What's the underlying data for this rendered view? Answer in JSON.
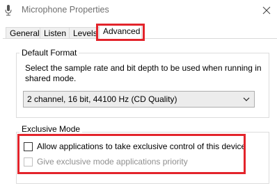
{
  "window": {
    "title": "Microphone Properties",
    "icon": "microphone-icon",
    "close_icon": "close-icon"
  },
  "tabs": [
    {
      "label": "General",
      "active": false
    },
    {
      "label": "Listen",
      "active": false
    },
    {
      "label": "Levels",
      "active": false
    },
    {
      "label": "Advanced",
      "active": true
    }
  ],
  "default_format": {
    "title": "Default Format",
    "description": "Select the sample rate and bit depth to be used when running in shared mode.",
    "selected": "2 channel, 16 bit, 44100 Hz (CD Quality)",
    "arrow_icon": "chevron-down-icon"
  },
  "exclusive_mode": {
    "title": "Exclusive Mode",
    "options": [
      {
        "label": "Allow applications to take exclusive control of this device",
        "checked": false,
        "enabled": true
      },
      {
        "label": "Give exclusive mode applications priority",
        "checked": false,
        "enabled": false
      }
    ]
  },
  "colors": {
    "highlight": "#e3242b",
    "disabled_text": "#8f8f8f",
    "title_text": "#6f6f6f"
  }
}
